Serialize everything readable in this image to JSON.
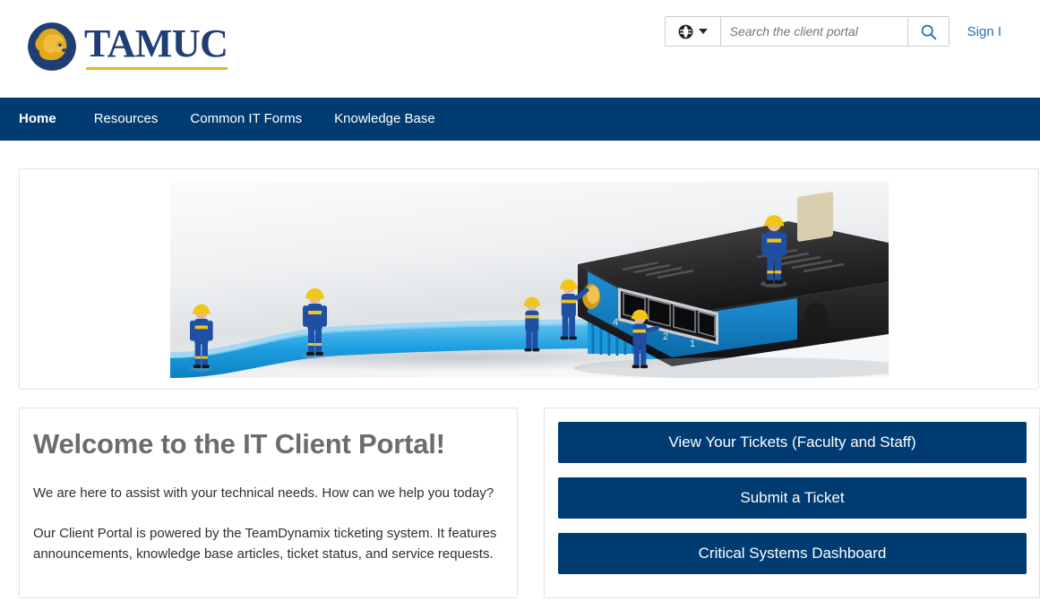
{
  "header": {
    "logo": {
      "wordmark": "TAMUC",
      "mark_name": "lion-head-logo",
      "navy": "#1f3e73",
      "gold": "#e8b622"
    },
    "search": {
      "scope_icon": "globe-icon",
      "scope_caret": "chevron-down-icon",
      "placeholder": "Search the client portal",
      "value": "",
      "submit_icon": "search-icon"
    },
    "sign_in_label": "Sign I"
  },
  "nav": {
    "background": "#003B71",
    "items": [
      {
        "label": "Home",
        "active": true
      },
      {
        "label": "Resources",
        "active": false
      },
      {
        "label": "Common IT Forms",
        "active": false
      },
      {
        "label": "Knowledge Base",
        "active": false
      }
    ]
  },
  "banner": {
    "image_alt": "Miniature figurines in blue uniforms and yellow hard hats plugging a blue ethernet cable into a black network router"
  },
  "welcome": {
    "title": "Welcome to the IT Client Portal!",
    "paragraph_1": "We are here to assist with your technical needs.  How can we help you today?",
    "paragraph_2": "Our Client Portal is powered by the TeamDynamix ticketing system.  It features announcements, knowledge base articles, ticket status, and service requests."
  },
  "actions": {
    "accent": "#003B71",
    "buttons": [
      {
        "label": "View Your Tickets (Faculty and Staff)"
      },
      {
        "label": "Submit a Ticket"
      },
      {
        "label": "Critical Systems Dashboard"
      }
    ]
  }
}
